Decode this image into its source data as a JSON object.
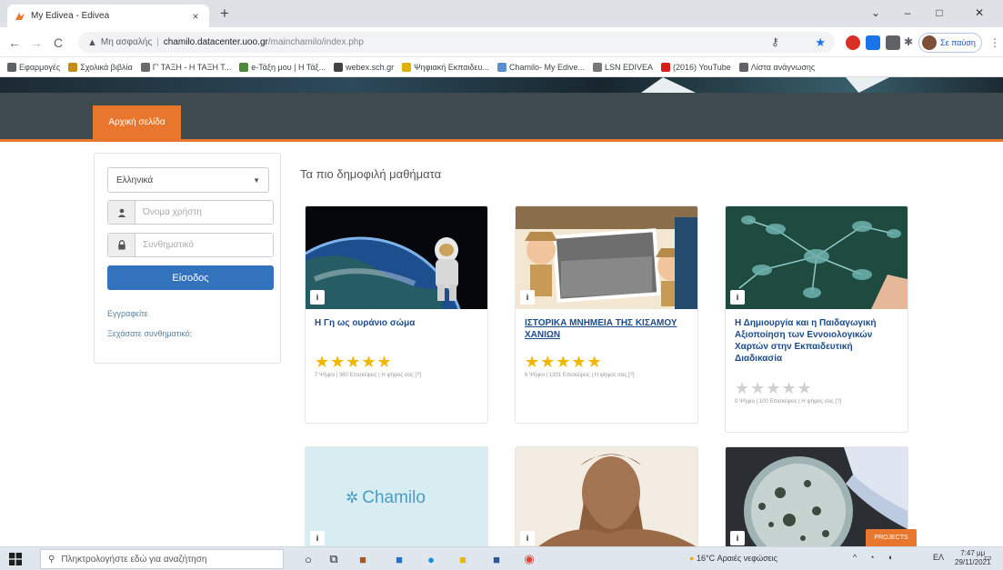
{
  "browser": {
    "tab_title": "My Edivea - Edivea",
    "tab_close": "×",
    "new_tab": "+",
    "window_controls": [
      "⌄",
      "–",
      "□",
      "✕"
    ],
    "nav": {
      "back": "←",
      "forward": "→",
      "reload": "C"
    },
    "address": {
      "security_label": "Μη ασφαλής",
      "host": "chamilo.datacenter.uoo.gr",
      "path": "/mainchamilo/index.php"
    },
    "profile_label": "Σε παύση"
  },
  "bookmarks": [
    {
      "label": "Εφαρμογές",
      "color": "#5f6368"
    },
    {
      "label": "Σχολικά βιβλία",
      "color": "#c68a1a"
    },
    {
      "label": "Γ' ΤΑΞΗ - Η ΤΑΞΗ Τ...",
      "color": "#6b6b6b"
    },
    {
      "label": "e-Τάξη μου | Η Τάξ...",
      "color": "#4a8a3a"
    },
    {
      "label": "webex.sch.gr",
      "color": "#444"
    },
    {
      "label": "Ψηφιακή Εκπαιδευ...",
      "color": "#e0b000"
    },
    {
      "label": "Chamilo- My Edive...",
      "color": "#5a8fd0"
    },
    {
      "label": "LSN EDIVEA",
      "color": "#777"
    },
    {
      "label": "(2016) YouTube",
      "color": "#d91e18"
    },
    {
      "label": "Λίστα ανάγνωσης",
      "color": "#5f6368"
    }
  ],
  "site": {
    "nav_home": "Αρχική σελίδα",
    "login": {
      "language": "Ελληνικά",
      "username_placeholder": "Όνομα χρήστη",
      "password_placeholder": "Συνθηματικό",
      "login_button": "Είσοδος",
      "register_link": "Εγγραφείτε",
      "lost_password_link": "Ξεχάσατε συνθηματικό;"
    },
    "popular_title": "Τα πιο δημοφιλή μαθήματα",
    "courses": [
      {
        "title": "Η Γη ως ουράνιο σώμα",
        "stars": "★★★★★",
        "rating": 5,
        "meta": "7 Ψήφοι | 360 Επισκέψεις | Η ψήφος σας [?]"
      },
      {
        "title": "ΙΣΤΟΡΙΚΑ ΜΝΗΜΕΙΑ ΤΗΣ ΚΙΣΑΜΟΥ ΧΑΝΙΩΝ",
        "stars": "★★★★★",
        "rating": 5,
        "meta": "6 Ψήφοι | 1301 Επισκέψεις | Η ψήφος σας [?]"
      },
      {
        "title": "Η Δημιουργία και η Παιδαγωγική Αξιοποίηση των Εννοιολογικών Χαρτών στην Εκπαιδευτική Διαδικασία",
        "stars": "★★★★★",
        "rating": 0,
        "meta": "0 Ψήφοι | 100 Επισκέψεις | Η ψήφος σας [?]"
      },
      {
        "logo_text": "Chamilo"
      },
      {},
      {}
    ],
    "badge": "i",
    "projects_button": "PROJECTS"
  },
  "taskbar": {
    "search_placeholder": "Πληκτρολογήστε εδώ για αναζήτηση",
    "weather": "16°C Αραιές νεφώσεις",
    "language": "ΕΛ",
    "time": "7:47 μμ",
    "date": "29/11/2021"
  }
}
